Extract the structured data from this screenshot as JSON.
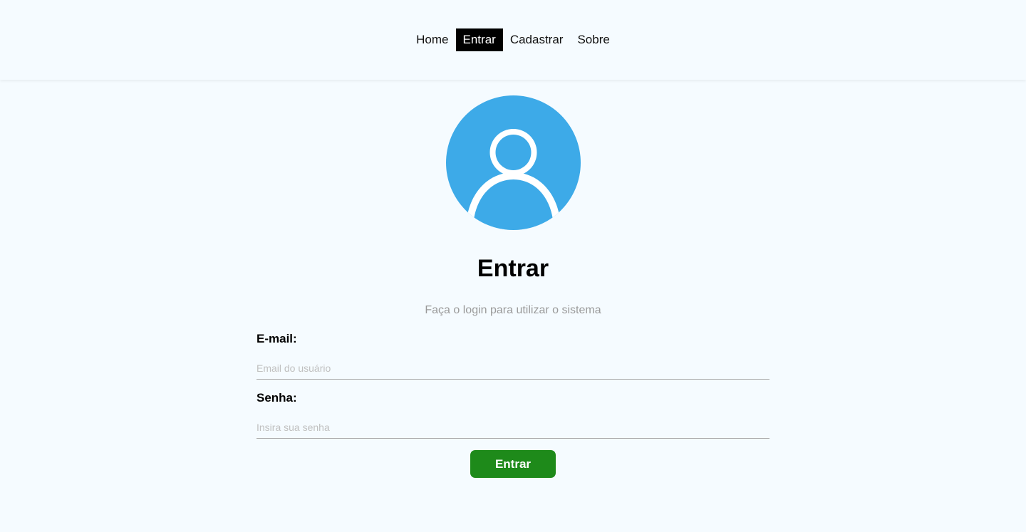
{
  "nav": {
    "items": [
      {
        "label": "Home",
        "active": false
      },
      {
        "label": "Entrar",
        "active": true
      },
      {
        "label": "Cadastrar",
        "active": false
      },
      {
        "label": "Sobre",
        "active": false
      }
    ]
  },
  "avatar": {
    "icon": "user-avatar-icon",
    "color": "#3daae8"
  },
  "page": {
    "title": "Entrar",
    "subtitle": "Faça o login para utilizar o sistema"
  },
  "form": {
    "email": {
      "label": "E-mail:",
      "placeholder": "Email do usuário",
      "value": ""
    },
    "password": {
      "label": "Senha:",
      "placeholder": "Insira sua senha",
      "value": ""
    },
    "submit_label": "Entrar"
  },
  "colors": {
    "background": "#f5fbff",
    "accent": "#3daae8",
    "submit": "#1e8a1a",
    "nav_active_bg": "#000000"
  }
}
